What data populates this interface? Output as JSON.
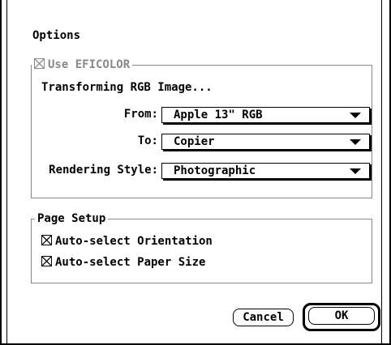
{
  "dialog": {
    "title": "Options"
  },
  "eficolor": {
    "group_label": "Use EFICOLOR",
    "checked": true,
    "enabled": false,
    "transform_heading": "Transforming RGB Image...",
    "from_label": "From:",
    "from_value": "Apple 13\" RGB",
    "to_label": "To:",
    "to_value": "Copier",
    "style_label": "Rendering Style:",
    "style_value": "Photographic"
  },
  "page_setup": {
    "group_label": "Page Setup",
    "orientation_label": "Auto-select Orientation",
    "orientation_checked": true,
    "paper_label": "Auto-select Paper Size",
    "paper_checked": true
  },
  "buttons": {
    "cancel": "Cancel",
    "ok": "OK"
  },
  "icons": {
    "checkbox_checked": "checkbox-checked-icon",
    "popup_arrow": "down-triangle-icon"
  }
}
